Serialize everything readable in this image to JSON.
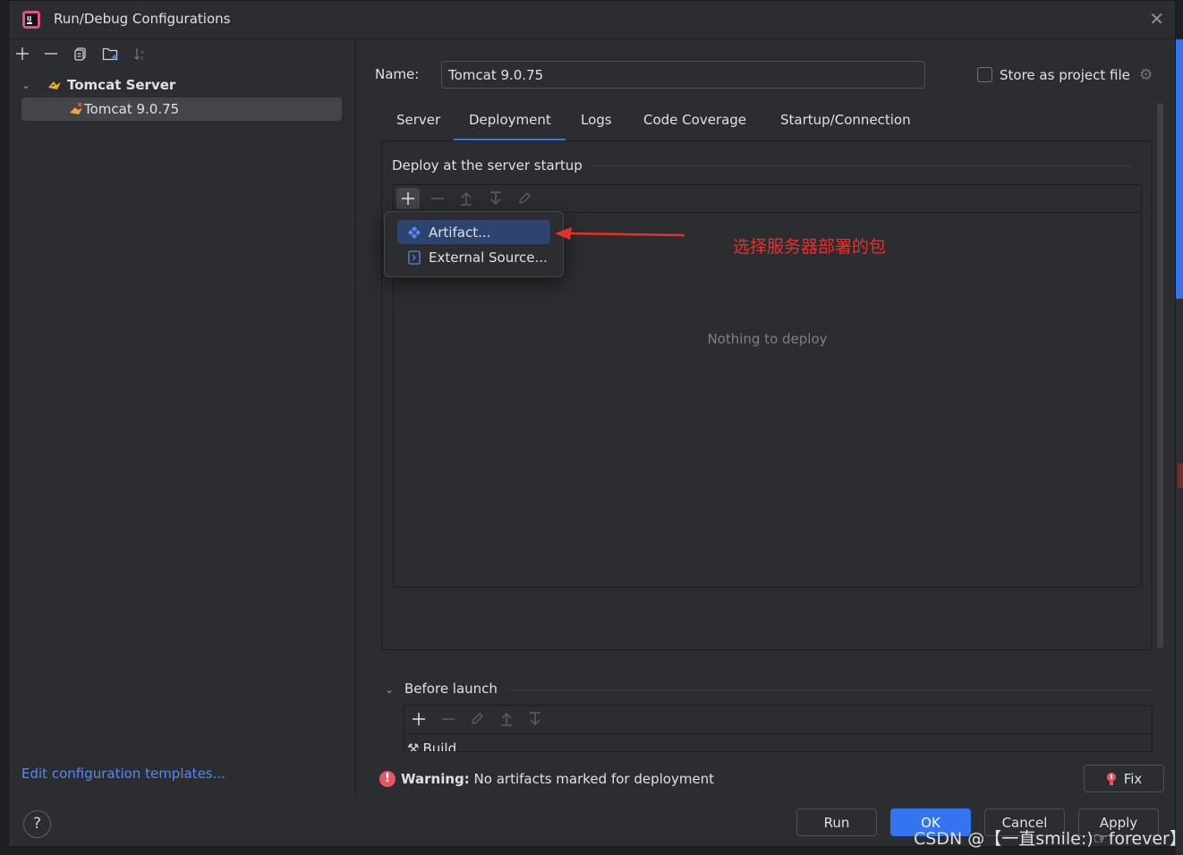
{
  "window": {
    "title": "Run/Debug Configurations"
  },
  "left_toolbar": {
    "icons": [
      "plus-icon",
      "minus-icon",
      "copy-icon",
      "folder-add-icon",
      "sort-icon"
    ]
  },
  "tree": {
    "group_label": "Tomcat Server",
    "item_label": "Tomcat 9.0.75"
  },
  "edit_templates_link": "Edit configuration templates...",
  "help_label": "?",
  "form": {
    "name_label": "Name:",
    "name_value": "Tomcat 9.0.75",
    "store_label": "Store as project file"
  },
  "tabs": [
    "Server",
    "Deployment",
    "Logs",
    "Code Coverage",
    "Startup/Connection"
  ],
  "active_tab": "Deployment",
  "deploy": {
    "section_title": "Deploy at the server startup",
    "empty_text": "Nothing to deploy"
  },
  "popup": {
    "items": [
      "Artifact...",
      "External Source..."
    ]
  },
  "annotation": "选择服务器部署的包",
  "before_launch": {
    "label": "Before launch",
    "item": "Build"
  },
  "warning": {
    "prefix": "Warning:",
    "text": "No artifacts marked for deployment"
  },
  "buttons": {
    "fix": "Fix",
    "run": "Run",
    "ok": "OK",
    "cancel": "Cancel",
    "apply": "Apply"
  },
  "watermark": "CSDN @【一直smile:)☞forever】",
  "colors": {
    "accent": "#3574f0",
    "annotation": "#e8302a",
    "warning": "#e55765",
    "link": "#548af7"
  }
}
